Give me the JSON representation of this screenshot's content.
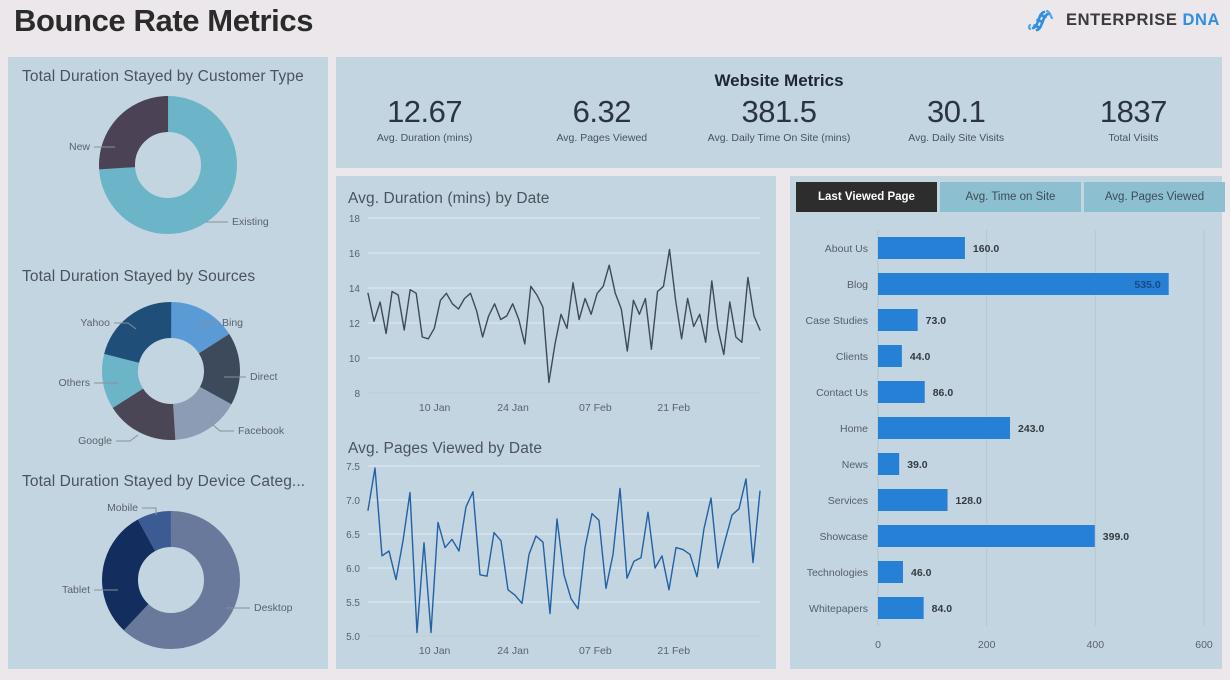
{
  "header": {
    "title": "Bounce Rate Metrics",
    "brand_primary": "ENTERPRISE",
    "brand_secondary": "DNA",
    "brand_icon": "dna-helix-icon"
  },
  "colors": {
    "page_background": "#ebe7ea",
    "panel_background": "#c3d5e0",
    "bar_blue": "#2680d6",
    "line_duration": "#3e4a5c",
    "line_pages": "#2360a5",
    "tab_active_bg": "#2d2d2d",
    "tab_inactive_bg": "#8cc0d0",
    "brand_blue": "#2f8fe0"
  },
  "kpi": {
    "title": "Website Metrics",
    "items": [
      {
        "value": "12.67",
        "label": "Avg. Duration (mins)"
      },
      {
        "value": "6.32",
        "label": "Avg. Pages Viewed"
      },
      {
        "value": "381.5",
        "label": "Avg. Daily Time On Site (mins)"
      },
      {
        "value": "30.1",
        "label": "Avg. Daily Site Visits"
      },
      {
        "value": "1837",
        "label": "Total Visits"
      }
    ]
  },
  "donuts": [
    {
      "title": "Total Duration Stayed by Customer Type",
      "chart_data": {
        "type": "pie",
        "title": "Total Duration Stayed by Customer Type",
        "categories": [
          "Existing",
          "New"
        ],
        "values": [
          74,
          26
        ],
        "colors": [
          "#6cb4c8",
          "#4b4256"
        ],
        "legend": "labels-with-leader-lines"
      }
    },
    {
      "title": "Total Duration Stayed by Sources",
      "chart_data": {
        "type": "pie",
        "title": "Total Duration Stayed by Sources",
        "categories": [
          "Bing",
          "Direct",
          "Facebook",
          "Google",
          "Others",
          "Yahoo"
        ],
        "values": [
          16,
          17,
          16,
          17,
          13,
          21
        ],
        "colors": [
          "#5b9bd5",
          "#3c4a5c",
          "#8b9cb4",
          "#4b4656",
          "#6cb4c8",
          "#1f4e79"
        ],
        "legend": "labels-with-leader-lines"
      }
    },
    {
      "title": "Total Duration Stayed by Device Categ...",
      "chart_data": {
        "type": "pie",
        "title": "Total Duration Stayed by Device Category",
        "categories": [
          "Desktop",
          "Tablet",
          "Mobile"
        ],
        "values": [
          62,
          30,
          8
        ],
        "colors": [
          "#68799b",
          "#132d5e",
          "#3c5b93"
        ],
        "legend": "labels-with-leader-lines"
      }
    }
  ],
  "line_charts": [
    {
      "title": "Avg. Duration (mins) by Date",
      "chart_data": {
        "type": "line",
        "title": "Avg. Duration (mins) by Date",
        "xlabel": "",
        "ylabel": "",
        "ylim": [
          8,
          18
        ],
        "yticks": [
          8,
          10,
          12,
          14,
          16,
          18
        ],
        "xticks": [
          "10 Jan",
          "24 Jan",
          "07 Feb",
          "21 Feb"
        ],
        "xtick_positions": [
          0.17,
          0.37,
          0.58,
          0.78
        ],
        "grid": true,
        "color": "#3e4a5c",
        "values": [
          13.7,
          12.1,
          13.2,
          11.4,
          13.8,
          13.6,
          11.6,
          13.9,
          13.7,
          11.2,
          11.1,
          11.7,
          13.3,
          13.7,
          13.1,
          12.8,
          13.4,
          13.7,
          12.7,
          11.2,
          12.4,
          13.1,
          12.2,
          12.4,
          13.1,
          12.2,
          10.8,
          14.1,
          13.6,
          12.9,
          8.6,
          10.8,
          12.5,
          11.7,
          14.3,
          12.2,
          13.4,
          12.5,
          13.7,
          14.1,
          15.3,
          13.7,
          12.8,
          10.4,
          13.3,
          12.5,
          13.4,
          10.5,
          13.8,
          14.1,
          16.2,
          13.3,
          11.1,
          13.4,
          11.8,
          12.5,
          10.9,
          14.4,
          11.7,
          10.2,
          13.2,
          11.2,
          10.9,
          14.6,
          12.4,
          11.6
        ]
      }
    },
    {
      "title": "Avg. Pages Viewed by Date",
      "chart_data": {
        "type": "line",
        "title": "Avg. Pages Viewed by Date",
        "xlabel": "",
        "ylabel": "",
        "ylim": [
          5.0,
          7.5
        ],
        "yticks": [
          "5.0",
          "5.5",
          "6.0",
          "6.5",
          "7.0",
          "7.5"
        ],
        "xticks": [
          "10 Jan",
          "24 Jan",
          "07 Feb",
          "21 Feb"
        ],
        "xtick_positions": [
          0.17,
          0.37,
          0.58,
          0.78
        ],
        "grid": true,
        "color": "#2360a5",
        "values": [
          6.85,
          7.47,
          6.18,
          6.25,
          5.83,
          6.4,
          7.11,
          5.05,
          6.37,
          5.05,
          6.67,
          6.3,
          6.42,
          6.25,
          6.9,
          7.12,
          5.9,
          5.88,
          6.52,
          6.4,
          5.68,
          5.6,
          5.48,
          6.2,
          6.47,
          6.38,
          5.33,
          6.72,
          5.9,
          5.55,
          5.4,
          6.3,
          6.8,
          6.7,
          5.7,
          6.2,
          7.17,
          5.85,
          6.1,
          6.15,
          6.82,
          6.0,
          6.18,
          5.68,
          6.3,
          6.27,
          6.2,
          5.87,
          6.58,
          7.03,
          6.0,
          6.4,
          6.78,
          6.87,
          7.31,
          6.08,
          7.13
        ]
      }
    }
  ],
  "bar_panel": {
    "tabs": [
      {
        "label": "Last Viewed Page",
        "active": true
      },
      {
        "label": "Avg. Time on Site",
        "active": false
      },
      {
        "label": "Avg. Pages Viewed",
        "active": false
      }
    ],
    "chart_data": {
      "type": "bar",
      "orientation": "horizontal",
      "title": "",
      "xlabel": "",
      "ylabel": "",
      "xlim": [
        0,
        600
      ],
      "xticks": [
        0,
        200,
        400,
        600
      ],
      "categories": [
        "About Us",
        "Blog",
        "Case Studies",
        "Clients",
        "Contact Us",
        "Home",
        "News",
        "Services",
        "Showcase",
        "Technologies",
        "Whitepapers"
      ],
      "values": [
        160.0,
        535.0,
        73.0,
        44.0,
        86.0,
        243.0,
        39.0,
        128.0,
        399.0,
        46.0,
        84.0
      ],
      "value_labels": [
        "160.0",
        "535.0",
        "73.0",
        "44.0",
        "86.0",
        "243.0",
        "39.0",
        "128.0",
        "399.0",
        "46.0",
        "84.0"
      ],
      "color": "#2680d6",
      "grid": true
    }
  }
}
